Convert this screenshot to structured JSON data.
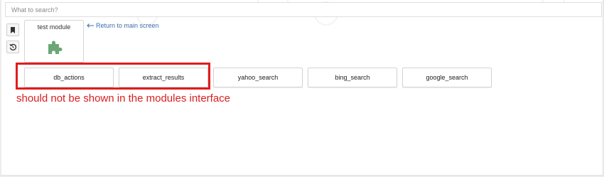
{
  "search": {
    "placeholder": "What to search?"
  },
  "sidebar": {
    "buttons": [
      {
        "icon": "bookmark-icon"
      },
      {
        "icon": "history-icon"
      }
    ]
  },
  "module": {
    "title": "test module",
    "icon": "puzzle-icon",
    "icon_color": "#6aa774"
  },
  "back_link": {
    "label": "Return to main screen",
    "icon": "arrow-left-icon"
  },
  "submodules": [
    "db_actions",
    "extract_results",
    "yahoo_search",
    "bing_search",
    "google_search"
  ],
  "annotation": {
    "text": "should not be shown in the modules interface",
    "color": "#e21c1c"
  }
}
